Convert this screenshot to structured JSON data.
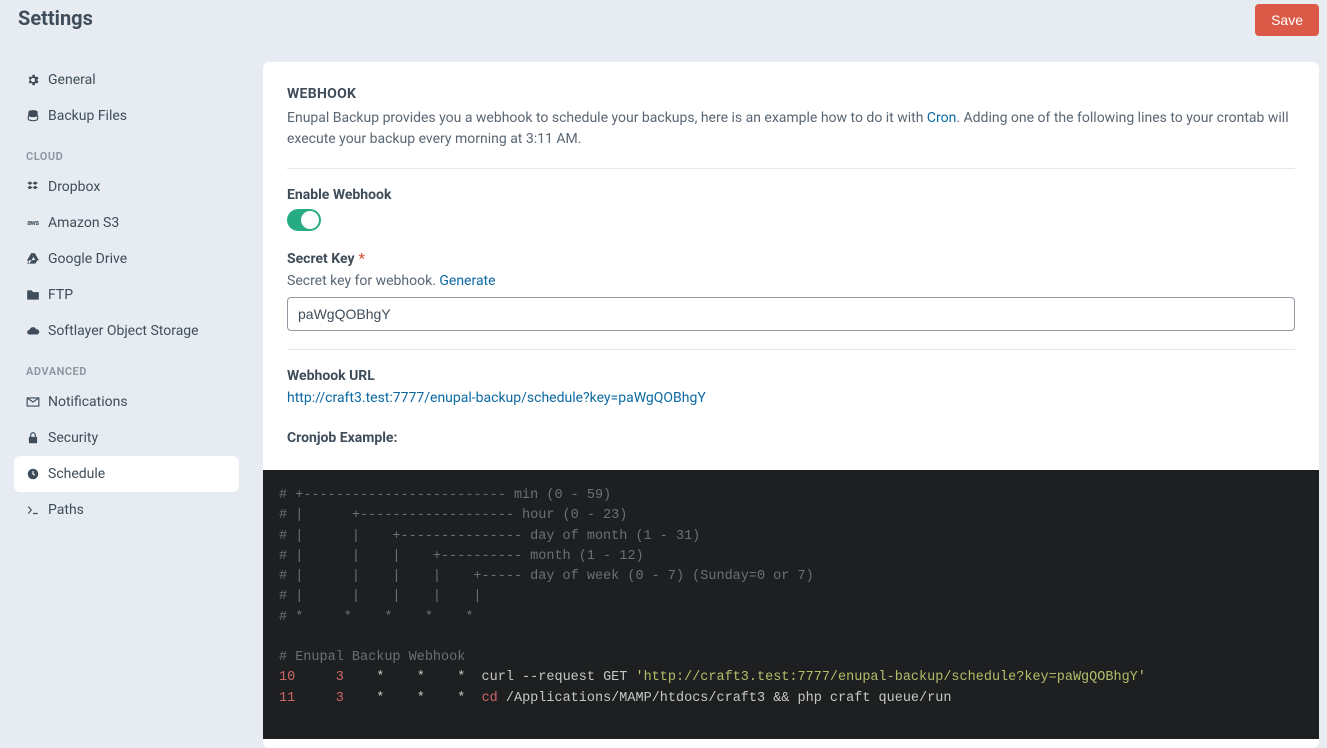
{
  "header": {
    "title": "Settings",
    "save_label": "Save"
  },
  "sidebar": {
    "items": [
      {
        "label": "General",
        "icon": "gear-icon"
      },
      {
        "label": "Backup Files",
        "icon": "database-icon"
      }
    ],
    "section_cloud": "CLOUD",
    "cloud_items": [
      {
        "label": "Dropbox",
        "icon": "dropbox-icon"
      },
      {
        "label": "Amazon S3",
        "icon": "aws-icon"
      },
      {
        "label": "Google Drive",
        "icon": "gdrive-icon"
      },
      {
        "label": "FTP",
        "icon": "folder-icon"
      },
      {
        "label": "Softlayer Object Storage",
        "icon": "cloud-icon"
      }
    ],
    "section_advanced": "ADVANCED",
    "advanced_items": [
      {
        "label": "Notifications",
        "icon": "envelope-icon"
      },
      {
        "label": "Security",
        "icon": "lock-icon"
      },
      {
        "label": "Schedule",
        "icon": "clock-icon",
        "active": true
      },
      {
        "label": "Paths",
        "icon": "terminal-icon"
      }
    ]
  },
  "main": {
    "webhook_heading": "WEBHOOK",
    "webhook_desc_pre": "Enupal Backup provides you a webhook to schedule your backups, here is an example how to do it with ",
    "webhook_cron_link": "Cron",
    "webhook_desc_post": ". Adding one of the following lines to your crontab will execute your backup every morning at 3:11 AM.",
    "enable_webhook_label": "Enable Webhook",
    "secret_key_label": "Secret Key",
    "secret_key_help": "Secret key for webhook. ",
    "generate_label": "Generate",
    "secret_key_value": "paWgQOBhgY",
    "webhook_url_label": "Webhook URL",
    "webhook_url_value": "http://craft3.test:7777/enupal-backup/schedule?key=paWgQOBhgY",
    "cronjob_example_label": "Cronjob Example:",
    "code": {
      "c1": "# +------------------------- min (0 - 59)",
      "c2": "# |      +------------------- hour (0 - 23)",
      "c3": "# |      |    +--------------- day of month (1 - 31)",
      "c4": "# |      |    |    +---------- month (1 - 12)",
      "c5": "# |      |    |    |    +----- day of week (0 - 7) (Sunday=0 or 7)",
      "c6": "# |      |    |    |    |",
      "c7": "# *     *    *    *    *",
      "c8": "",
      "c9": "# Enupal Backup Webhook",
      "l1_a": "10",
      "l1_b": "3",
      "l1_c": "    *    *    *  curl --request GET ",
      "l1_d": "'http://craft3.test:7777/enupal-backup/schedule?key=paWgQOBhgY'",
      "l2_a": "11",
      "l2_b": "3",
      "l2_c": "    *    *    *  ",
      "l2_d": "cd",
      "l2_e": " /Applications/MAMP/htdocs/craft3 && php craft queue/run"
    }
  }
}
